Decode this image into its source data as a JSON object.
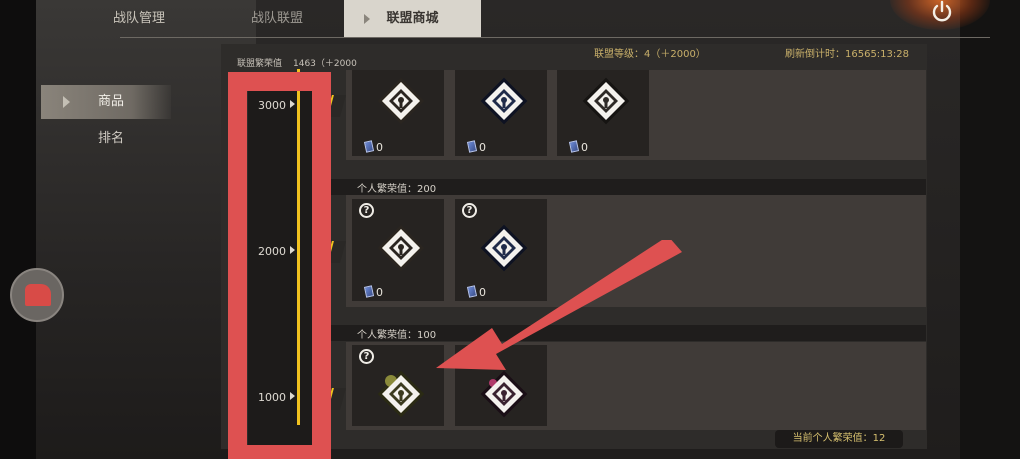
{
  "top_tabs": [
    {
      "label": "战队管理"
    },
    {
      "label": "战队联盟"
    },
    {
      "label": "联盟商城"
    }
  ],
  "side_menu": [
    {
      "label": "商品"
    },
    {
      "label": "排名"
    }
  ],
  "info": {
    "level": "联盟等级：4（＋2000）",
    "refresh": "刷新倒计时：16565:13:28",
    "prosperity_label": "联盟繁荣值",
    "prosperity_value": "1463（＋2000"
  },
  "milestones": [
    {
      "label": "3000"
    },
    {
      "label": "2000"
    },
    {
      "label": "1000"
    }
  ],
  "tiers": [
    {
      "header": "",
      "items": [
        {
          "cost": "0",
          "style": "gold-camo"
        },
        {
          "cost": "0",
          "style": "dark-blue"
        },
        {
          "cost": "0",
          "style": "dark"
        }
      ]
    },
    {
      "header": "个人繁荣值：200",
      "items": [
        {
          "cost": "0",
          "style": "gold-camo"
        },
        {
          "cost": "0",
          "style": "dark-blue"
        }
      ]
    },
    {
      "header": "个人繁荣值：100",
      "items": [
        {
          "cost": "",
          "style": "green-camo"
        },
        {
          "cost": "",
          "style": "dark-pink"
        }
      ]
    }
  ],
  "help_glyph": "?",
  "current_value": "当前个人繁荣值：12",
  "colors": {
    "accent_yellow": "#f1c21f",
    "annotation_red": "#de5151",
    "text_gold": "#c9b06a"
  },
  "icons": [
    "power-icon",
    "help-icon",
    "lock-emblem-icon",
    "card-currency-icon",
    "arrow-right-icon"
  ]
}
